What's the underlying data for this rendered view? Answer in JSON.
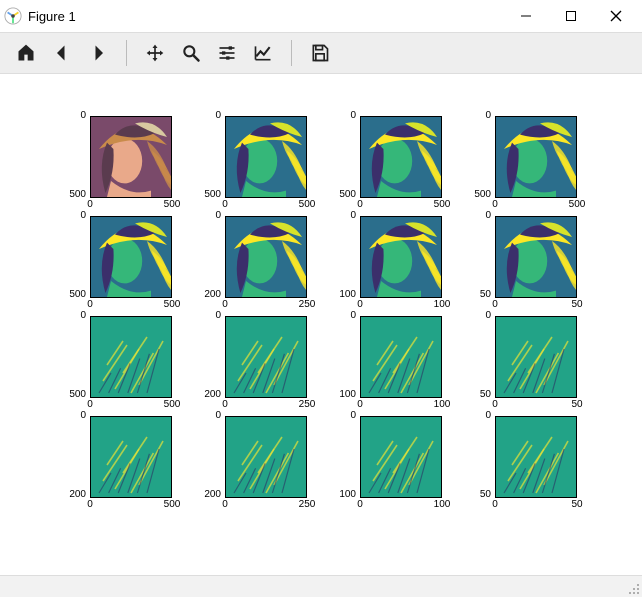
{
  "window": {
    "title": "Figure 1"
  },
  "toolbar": {
    "buttons": [
      {
        "name": "home-button",
        "icon": "home-icon"
      },
      {
        "name": "back-button",
        "icon": "arrow-left-icon"
      },
      {
        "name": "forward-button",
        "icon": "arrow-right-icon"
      },
      {
        "sep": true
      },
      {
        "name": "pan-button",
        "icon": "move-icon"
      },
      {
        "name": "zoom-button",
        "icon": "search-icon"
      },
      {
        "name": "subplots-button",
        "icon": "sliders-icon"
      },
      {
        "name": "axes-button",
        "icon": "chart-line-icon"
      },
      {
        "sep": true
      },
      {
        "name": "save-button",
        "icon": "save-icon"
      }
    ]
  },
  "grid": {
    "rows": 4,
    "cols": 4,
    "subplots": [
      {
        "r": 0,
        "c": 0,
        "yticks": [
          "0",
          "500"
        ],
        "xticks": [
          "0",
          "500"
        ],
        "style": "rgb"
      },
      {
        "r": 0,
        "c": 1,
        "yticks": [
          "0",
          "500"
        ],
        "xticks": [
          "0",
          "500"
        ],
        "style": "viridis"
      },
      {
        "r": 0,
        "c": 2,
        "yticks": [
          "0",
          "500"
        ],
        "xticks": [
          "0",
          "500"
        ],
        "style": "viridis"
      },
      {
        "r": 0,
        "c": 3,
        "yticks": [
          "0",
          "500"
        ],
        "xticks": [
          "0",
          "500"
        ],
        "style": "viridis"
      },
      {
        "r": 1,
        "c": 0,
        "yticks": [
          "0",
          "500"
        ],
        "xticks": [
          "0",
          "500"
        ],
        "style": "viridis"
      },
      {
        "r": 1,
        "c": 1,
        "yticks": [
          "0",
          "200"
        ],
        "xticks": [
          "0",
          "250"
        ],
        "style": "viridis"
      },
      {
        "r": 1,
        "c": 2,
        "yticks": [
          "0",
          "100"
        ],
        "xticks": [
          "0",
          "100"
        ],
        "style": "viridis"
      },
      {
        "r": 1,
        "c": 3,
        "yticks": [
          "0",
          "50"
        ],
        "xticks": [
          "0",
          "50"
        ],
        "style": "viridis"
      },
      {
        "r": 2,
        "c": 0,
        "yticks": [
          "0",
          "500"
        ],
        "xticks": [
          "0",
          "500"
        ],
        "style": "greenish"
      },
      {
        "r": 2,
        "c": 1,
        "yticks": [
          "0",
          "200"
        ],
        "xticks": [
          "0",
          "250"
        ],
        "style": "greenish"
      },
      {
        "r": 2,
        "c": 2,
        "yticks": [
          "0",
          "100"
        ],
        "xticks": [
          "0",
          "100"
        ],
        "style": "greenish"
      },
      {
        "r": 2,
        "c": 3,
        "yticks": [
          "0",
          "50"
        ],
        "xticks": [
          "0",
          "50"
        ],
        "style": "greenish"
      },
      {
        "r": 3,
        "c": 0,
        "yticks": [
          "0",
          "200"
        ],
        "xticks": [
          "0",
          "500"
        ],
        "style": "greenish"
      },
      {
        "r": 3,
        "c": 1,
        "yticks": [
          "0",
          "200"
        ],
        "xticks": [
          "0",
          "250"
        ],
        "style": "greenish"
      },
      {
        "r": 3,
        "c": 2,
        "yticks": [
          "0",
          "100"
        ],
        "xticks": [
          "0",
          "100"
        ],
        "style": "greenish"
      },
      {
        "r": 3,
        "c": 3,
        "yticks": [
          "0",
          "50"
        ],
        "xticks": [
          "0",
          "50"
        ],
        "style": "greenish"
      }
    ]
  }
}
